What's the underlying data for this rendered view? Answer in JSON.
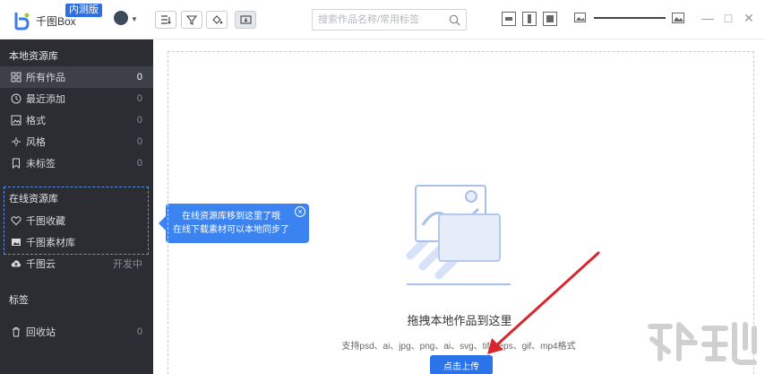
{
  "app": {
    "brand": "千图Box",
    "badge": "内测版"
  },
  "search": {
    "placeholder": "搜索作品名称/常用标签"
  },
  "sidebar": {
    "local_title": "本地资源库",
    "local_items": [
      {
        "label": "所有作品",
        "count": "0",
        "icon": "grid-icon"
      },
      {
        "label": "最近添加",
        "count": "0",
        "icon": "clock-icon"
      },
      {
        "label": "格式",
        "count": "0",
        "icon": "image-format-icon"
      },
      {
        "label": "风格",
        "count": "0",
        "icon": "style-icon"
      },
      {
        "label": "未标签",
        "count": "0",
        "icon": "bookmark-icon"
      }
    ],
    "online_title": "在线资源库",
    "online_items": [
      {
        "label": "千图收藏",
        "icon": "heart-icon"
      },
      {
        "label": "千图素材库",
        "icon": "image-library-icon"
      }
    ],
    "cloud_item": {
      "label": "千图云",
      "status": "开发中",
      "icon": "cloud-upload-icon"
    },
    "tags_title": "标签",
    "trash": {
      "label": "回收站",
      "count": "0",
      "icon": "trash-icon"
    }
  },
  "tooltip": {
    "line1": "在线资源库移到这里了哦",
    "line2": "在线下载素材可以本地同步了",
    "close": "×"
  },
  "main": {
    "drop_title": "拖拽本地作品到这里",
    "drop_sub": "支持psd、ai、jpg、png、ai、svg、tif、eps、gif、mp4格式",
    "upload_label": "点击上传"
  },
  "window": {
    "minimize": "—",
    "maximize": "□",
    "close": "✕"
  },
  "colors": {
    "sidebar_bg": "#2b2d33",
    "accent": "#2a73e8",
    "tooltip_bg": "#3c83f2",
    "annotation_arrow": "#d9262c"
  }
}
